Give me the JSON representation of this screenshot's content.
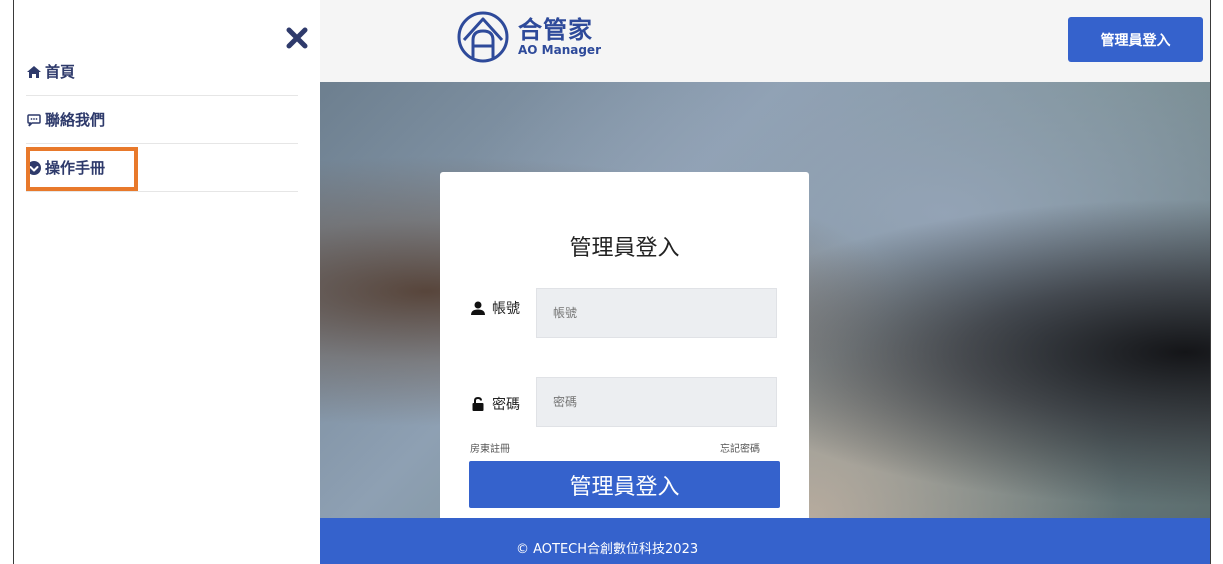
{
  "sidebar": {
    "items": [
      {
        "label": "首頁",
        "icon": "home-icon"
      },
      {
        "label": "聯絡我們",
        "icon": "chat-icon"
      },
      {
        "label": "操作手冊",
        "icon": "download-circle-icon"
      }
    ],
    "highlight_color": "#e8792b"
  },
  "header": {
    "logo_title": "合管家",
    "logo_subtitle": "AO Manager",
    "admin_login_button": "管理員登入"
  },
  "login": {
    "title": "管理員登入",
    "account_label": "帳號",
    "account_placeholder": "帳號",
    "password_label": "密碼",
    "password_placeholder": "密碼",
    "register_link": "房東註冊",
    "forgot_link": "忘記密碼",
    "submit_button": "管理員登入"
  },
  "footer": {
    "text": "© AOTECH合創數位科技2023"
  },
  "colors": {
    "brand_blue": "#3562cc",
    "nav_text": "#2e3a6b"
  }
}
